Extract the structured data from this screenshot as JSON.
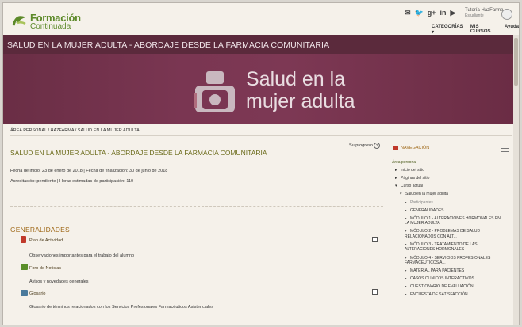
{
  "brand": {
    "line1": "Formación",
    "line2": "Continuada"
  },
  "social": [
    {
      "name": "email-icon",
      "glyph": "✉"
    },
    {
      "name": "twitter-icon",
      "glyph": "🐦"
    },
    {
      "name": "google-plus-icon",
      "glyph": "g+"
    },
    {
      "name": "linkedin-icon",
      "glyph": "in"
    },
    {
      "name": "youtube-icon",
      "glyph": "▶"
    }
  ],
  "user": {
    "name": "Tutoría HazFarma",
    "role": "Estudiante"
  },
  "nav": {
    "categorias": "CATEGORÍAS ▾",
    "mis_cursos": "MIS CURSOS",
    "ayuda": "Ayuda"
  },
  "band_title": "SALUD EN LA MUJER ADULTA - ABORDAJE DESDE LA FARMACIA COMUNITARIA",
  "banner": {
    "line1": "Salud en la",
    "line2": "mujer adulta"
  },
  "breadcrumb": {
    "home": "ÁREA PERSONAL",
    "sep": "/",
    "second": "HAZFARMA",
    "current": "SALUD EN LA MUJER ADULTA"
  },
  "course": {
    "title": "SALUD EN LA MUJER ADULTA - ABORDAJE DESDE LA FARMACIA COMUNITARIA",
    "progress_label": "Su progreso",
    "dates": "Fecha de inicio: 23 de enero de 2018 | Fecha de finalización: 30 de junio de 2018",
    "accreditation": "Acreditación: pendiente | Horas estimadas de participación: 110"
  },
  "section": {
    "title": "GENERALIDADES",
    "activities": [
      {
        "label": "Plan de Actividad",
        "desc": "Observaciones importantes para el trabajo del alumno"
      },
      {
        "label": "Foro de Noticias",
        "desc": "Avisos y novedades generales"
      },
      {
        "label": "Glosario",
        "desc": "Glosario de términos relacionados con los Servicios Profesionales Farmacéuticos Asistenciales"
      }
    ]
  },
  "navigation": {
    "title": "NAVEGACIÓN",
    "items": [
      {
        "label": "Área personal",
        "level": 0,
        "arrow": ""
      },
      {
        "label": "Inicio del sitio",
        "level": 1,
        "arrow": "▸"
      },
      {
        "label": "Páginas del sitio",
        "level": 1,
        "arrow": "▸"
      },
      {
        "label": "Curso actual",
        "level": 1,
        "arrow": "▾"
      },
      {
        "label": "Salud en la mujer adulta",
        "level": 2,
        "arrow": "▾"
      },
      {
        "label": "Participantes",
        "level": 3,
        "arrow": "▸"
      },
      {
        "label": "GENERALIDADES",
        "level": 3,
        "arrow": "▸"
      },
      {
        "label": "MÓDULO 1 - ALTERACIONES HORMONALES EN LA MUJER ADULTA",
        "level": 3,
        "arrow": "▸"
      },
      {
        "label": "MÓDULO 2 - PROBLEMAS DE SALUD RELACIONADOS CON ALT...",
        "level": 3,
        "arrow": "▸"
      },
      {
        "label": "MÓDULO 3 - TRATAMIENTO DE LAS ALTERACIONES HORMONALES",
        "level": 3,
        "arrow": "▸"
      },
      {
        "label": "MÓDULO 4 - SERVICIOS PROFESIONALES FARMACÉUTICOS A...",
        "level": 3,
        "arrow": "▸"
      },
      {
        "label": "MATERIAL PARA PACIENTES",
        "level": 3,
        "arrow": "▸"
      },
      {
        "label": "CASOS CLÍNICOS INTERACTIVOS",
        "level": 3,
        "arrow": "▸"
      },
      {
        "label": "CUESTIONARIO DE EVALUACIÓN",
        "level": 3,
        "arrow": "▸"
      },
      {
        "label": "ENCUESTA DE SATISFACCIÓN",
        "level": 3,
        "arrow": "▸"
      }
    ]
  },
  "colors": {
    "brand_green": "#5d8a2a",
    "band": "#5b2a3c",
    "section_orange": "#a06a1a"
  }
}
